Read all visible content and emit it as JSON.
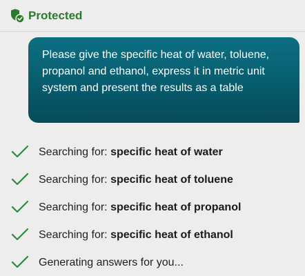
{
  "header": {
    "status_label": "Protected",
    "status_color": "#2b7a2b",
    "icon": "shield-check-icon"
  },
  "user_message": {
    "text": "Please give the specific heat of water, toluene, propanol and ethanol, express it in metric unit system and present the results as a table",
    "background_color": "#075e6f"
  },
  "steps": [
    {
      "prefix": "Searching for: ",
      "query": "specific heat of water",
      "icon": "checkmark-icon"
    },
    {
      "prefix": "Searching for: ",
      "query": "specific heat of toluene",
      "icon": "checkmark-icon"
    },
    {
      "prefix": "Searching for: ",
      "query": "specific heat of propanol",
      "icon": "checkmark-icon"
    },
    {
      "prefix": "Searching for: ",
      "query": "specific heat of ethanol",
      "icon": "checkmark-icon"
    },
    {
      "prefix": "Generating answers for you...",
      "query": "",
      "icon": "checkmark-icon"
    }
  ],
  "colors": {
    "check_green": "#2b8a3e",
    "background": "#ededed"
  }
}
